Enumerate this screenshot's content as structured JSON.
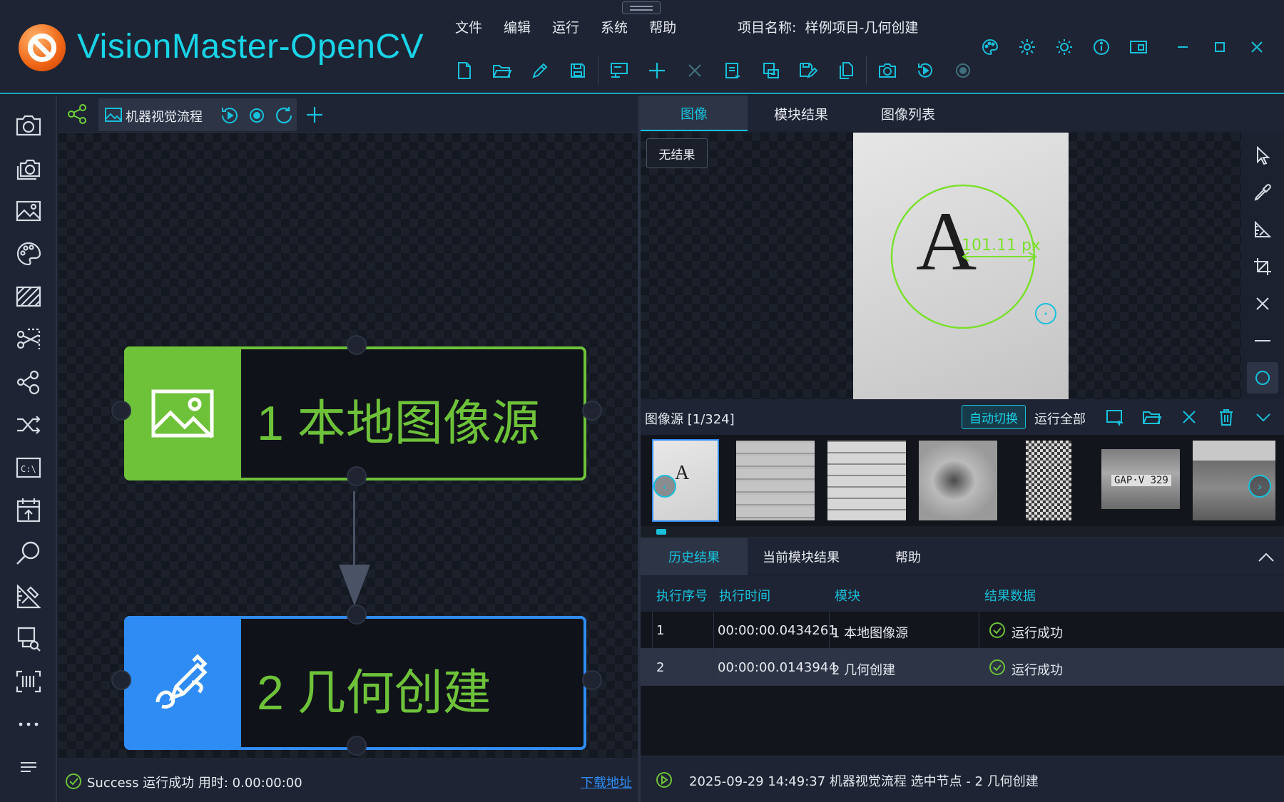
{
  "app": {
    "title": "VisionMaster-OpenCV"
  },
  "menu": [
    "文件",
    "编辑",
    "运行",
    "系统",
    "帮助"
  ],
  "project": {
    "label": "项目名称:",
    "name": "样例项目-几何创建"
  },
  "flow": {
    "tab_label": "机器视觉流程",
    "nodes": [
      {
        "label": "1 本地图像源",
        "color": "#6ec23a"
      },
      {
        "label": "2 几何创建",
        "color": "#2f8cf5"
      }
    ],
    "status": "Success 运行成功 用时: 0.00:00:00",
    "download": "下载地址"
  },
  "image_panel": {
    "tabs": [
      "图像",
      "模块结果",
      "图像列表"
    ],
    "active_tab": "图像",
    "no_result": "无结果",
    "measure_label": "101.11 px"
  },
  "source_bar": {
    "label": "图像源 [1/324]",
    "auto_switch": "自动切换",
    "run_all": "运行全部",
    "thumbnails": {
      "first_letter": "A",
      "plate_text": "GAP·V 329"
    }
  },
  "results": {
    "tabs": [
      "历史结果",
      "当前模块结果",
      "帮助"
    ],
    "active_tab": "历史结果",
    "columns": [
      "执行序号",
      "执行时间",
      "模块",
      "结果数据"
    ],
    "rows": [
      {
        "id": "1",
        "time": "00:00:00.0434261",
        "module": "1 本地图像源",
        "result": "运行成功"
      },
      {
        "id": "2",
        "time": "00:00:00.0143944",
        "module": "2 几何创建",
        "result": "运行成功"
      }
    ]
  },
  "status_bar": {
    "text": "2025-09-29 14:49:37  机器视觉流程 选中节点 - 2 几何创建"
  },
  "colors": {
    "accent": "#19c0da",
    "success": "#6ec23a",
    "blue": "#2f8cf5",
    "bg": "#1c2130"
  }
}
